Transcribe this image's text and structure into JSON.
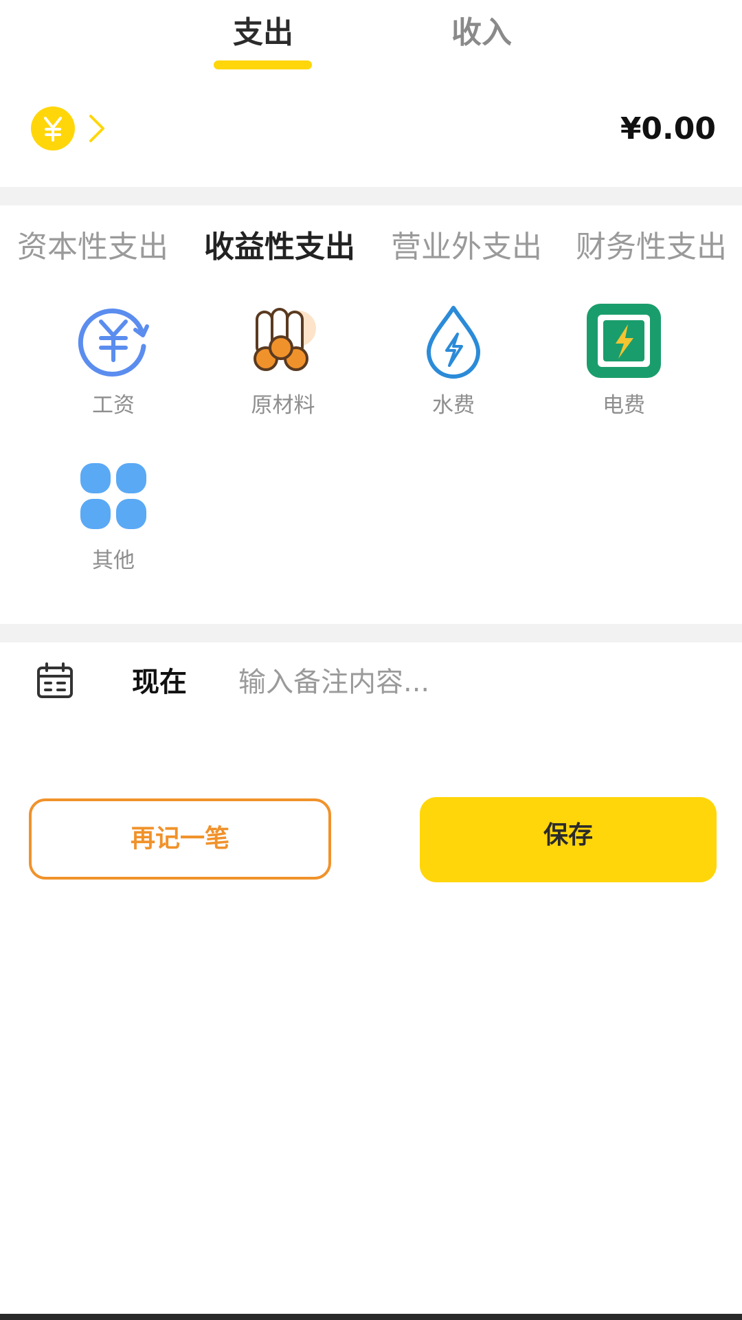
{
  "header": {
    "tabs": [
      {
        "label": "支出",
        "active": true
      },
      {
        "label": "收入",
        "active": false
      }
    ]
  },
  "amount_row": {
    "currency_icon": "yuan-coin-icon",
    "chevron_icon": "chevron-right-icon",
    "amount": "¥0.00"
  },
  "category_tabs": [
    {
      "label": "资本性支出",
      "active": false
    },
    {
      "label": "收益性支出",
      "active": true
    },
    {
      "label": "营业外支出",
      "active": false
    },
    {
      "label": "财务性支出",
      "active": false
    }
  ],
  "categories": [
    {
      "label": "工资",
      "icon": "salary-icon"
    },
    {
      "label": "原材料",
      "icon": "raw-materials-icon"
    },
    {
      "label": "水费",
      "icon": "water-fee-icon"
    },
    {
      "label": "电费",
      "icon": "electricity-fee-icon"
    },
    {
      "label": "其他",
      "icon": "other-icon"
    }
  ],
  "entry_row": {
    "calendar_icon": "calendar-icon",
    "date": "现在",
    "note_placeholder": "输入备注内容...",
    "note_value": ""
  },
  "actions": {
    "again_label": "再记一笔",
    "save_label": "保存"
  },
  "colors": {
    "accent": "#ffd60a",
    "orange": "#f0922b",
    "text_active": "#2b2b2b",
    "text_inactive": "#9a9a9a",
    "divider": "#f2f2f2"
  }
}
